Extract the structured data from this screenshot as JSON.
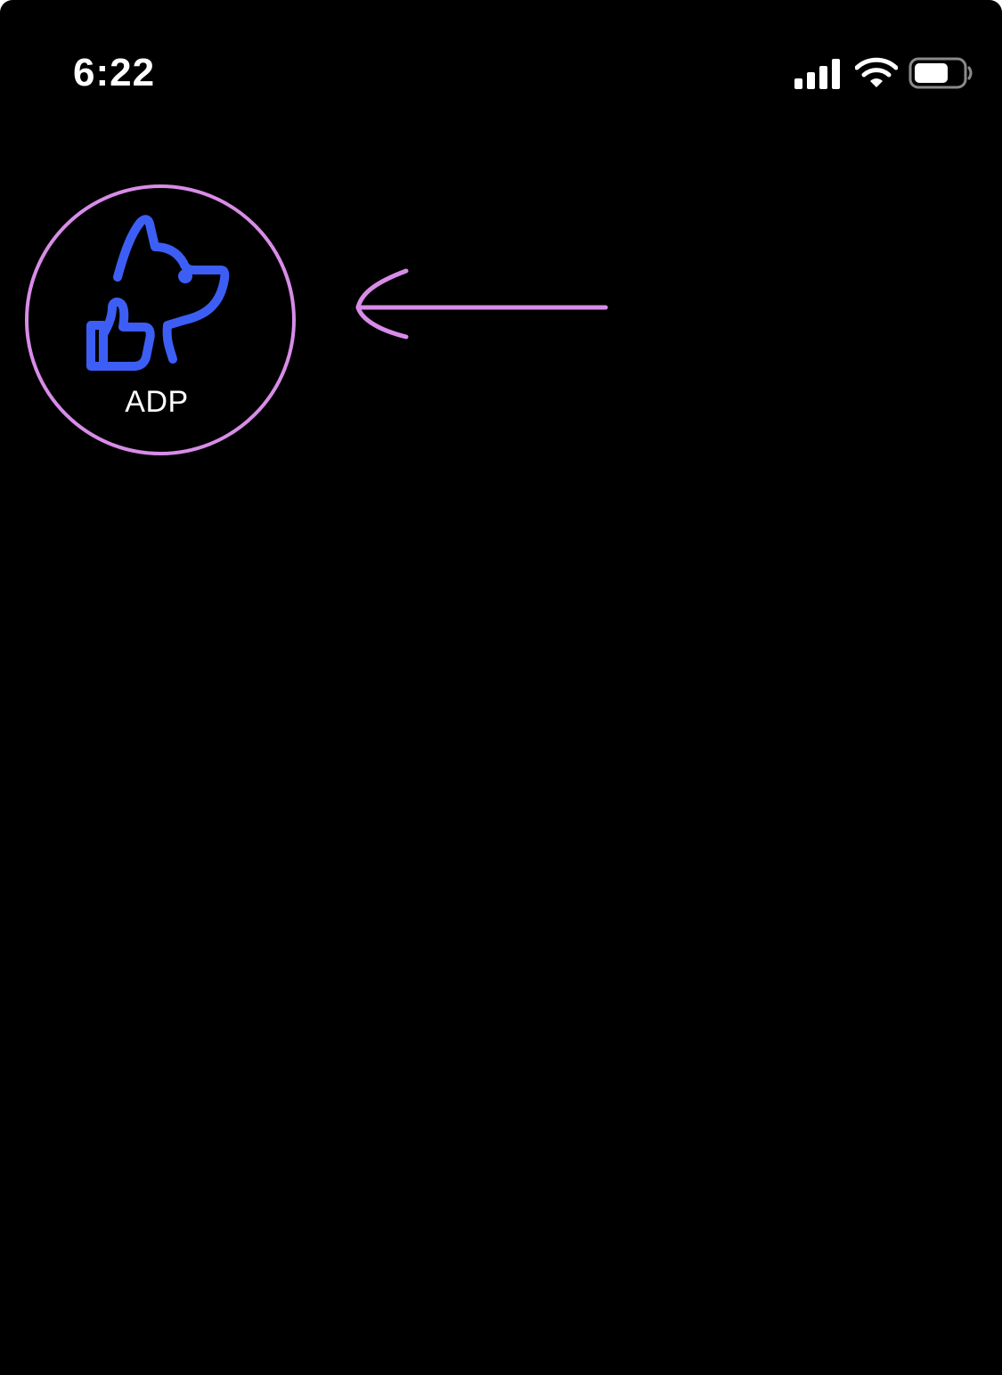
{
  "status_bar": {
    "time": "6:22",
    "icons": [
      "signal-icon",
      "wifi-icon",
      "battery-icon"
    ],
    "battery_level": 0.72
  },
  "app_icon": {
    "label": "ADP",
    "icon": "dog-thumbs-up-icon",
    "icon_color": "#3d5ef5"
  },
  "annotation": {
    "color": "#d88ce8",
    "arrow": "left-arrow-icon"
  },
  "colors": {
    "background": "#000000",
    "text": "#ffffff"
  }
}
